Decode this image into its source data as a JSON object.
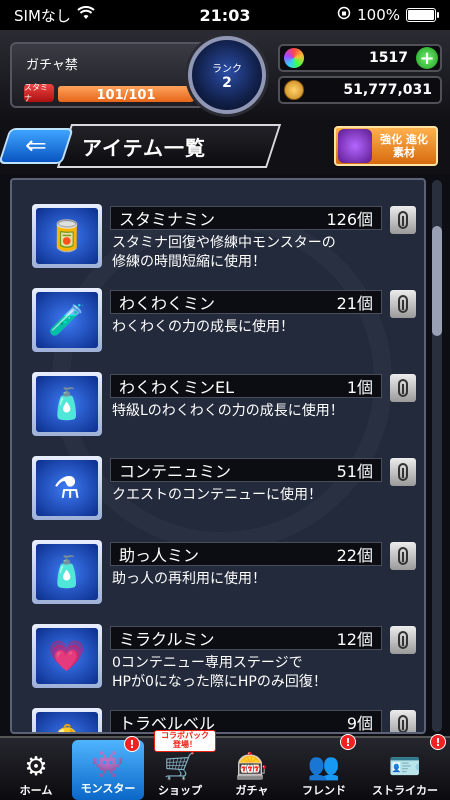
{
  "status_bar": {
    "carrier": "SIMなし",
    "time": "21:03",
    "battery": "100%"
  },
  "header": {
    "player_name": "ガチャ禁",
    "stamina_label": "スタミナ",
    "stamina_text": "101/101",
    "stamina_ratio": 1.0,
    "rank_label": "ランク",
    "rank_value": "2",
    "orbs": "1517",
    "coins": "51,777,031"
  },
  "title_bar": {
    "title": "アイテム一覧",
    "upgrade_line1": "強化 進化",
    "upgrade_line2": "素材"
  },
  "items": [
    {
      "name": "スタミナミン",
      "count": "126個",
      "desc1": "スタミナ回復や修練中モンスターの",
      "desc2": "修練の時間短縮に使用！",
      "icon": "🥫"
    },
    {
      "name": "わくわくミン",
      "count": "21個",
      "desc1": "わくわくの力の成長に使用！",
      "desc2": "",
      "icon": "🧪"
    },
    {
      "name": "わくわくミンEL",
      "count": "1個",
      "desc1": "特級Lのわくわくの力の成長に使用！",
      "desc2": "",
      "icon": "🧴"
    },
    {
      "name": "コンテニュミン",
      "count": "51個",
      "desc1": "クエストのコンテニューに使用！",
      "desc2": "",
      "icon": "⚗"
    },
    {
      "name": "助っ人ミン",
      "count": "22個",
      "desc1": "助っ人の再利用に使用！",
      "desc2": "",
      "icon": "🧴"
    },
    {
      "name": "ミラクルミン",
      "count": "12個",
      "desc1": "0コンテニュー専用ステージで",
      "desc2": "HPが0になった際にHPのみ回復！",
      "icon": "💗"
    },
    {
      "name": "トラベルベル",
      "count": "9個",
      "desc1": "",
      "desc2": "",
      "icon": "🔔"
    }
  ],
  "nav": [
    {
      "label": "ホーム",
      "icon": "⚙",
      "alert": false
    },
    {
      "label": "モンスター",
      "icon": "👾",
      "alert": true
    },
    {
      "label": "ショップ",
      "icon": "🛒",
      "alert": true,
      "tag": "コラボパック登場！"
    },
    {
      "label": "ガチャ",
      "icon": "🎰",
      "alert": false
    },
    {
      "label": "フレンド",
      "icon": "👥",
      "alert": true
    },
    {
      "label": "ストライカー",
      "icon": "🪪",
      "alert": true
    }
  ]
}
